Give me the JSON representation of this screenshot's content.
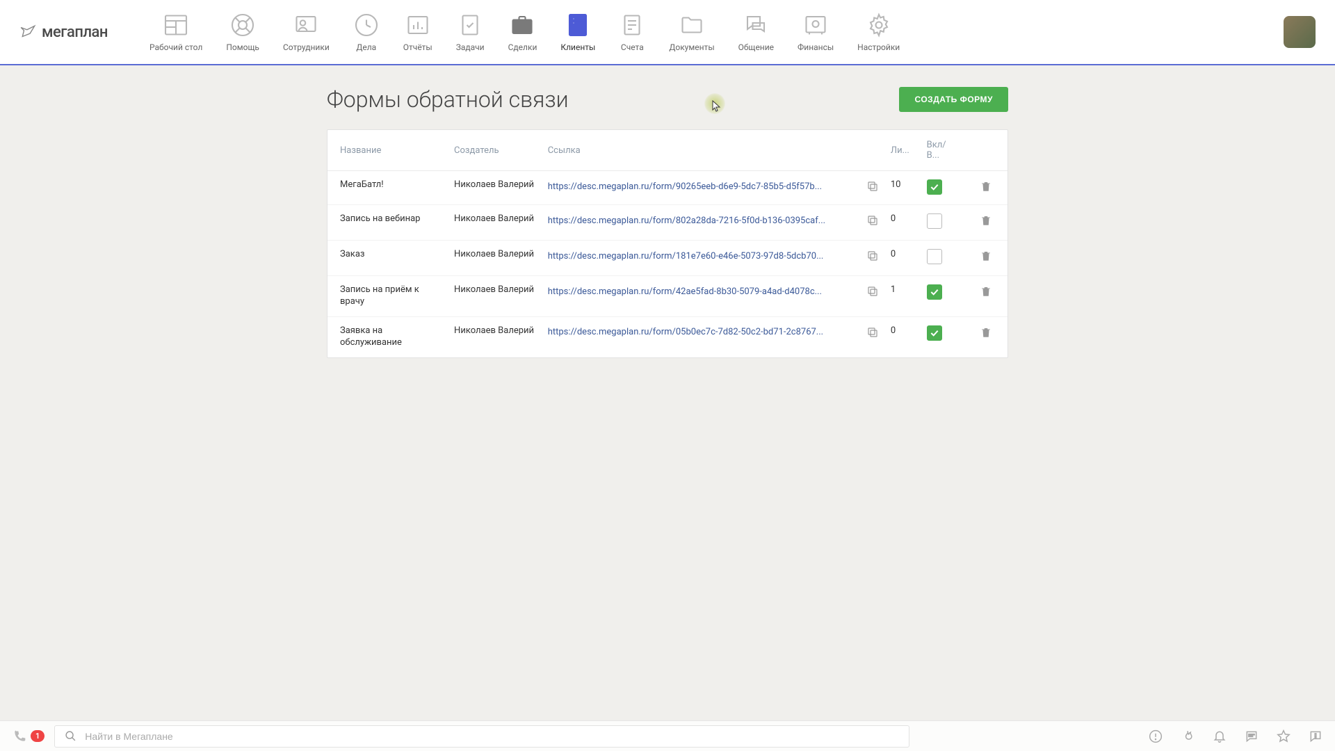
{
  "logo": "мегаплан",
  "topnav": [
    {
      "label": "Рабочий стол"
    },
    {
      "label": "Помощь"
    },
    {
      "label": "Сотрудники"
    },
    {
      "label": "Дела"
    },
    {
      "label": "Отчёты"
    },
    {
      "label": "Задачи"
    },
    {
      "label": "Сделки"
    },
    {
      "label": "Клиенты"
    },
    {
      "label": "Счета"
    },
    {
      "label": "Документы"
    },
    {
      "label": "Общение"
    },
    {
      "label": "Финансы"
    },
    {
      "label": "Настройки"
    }
  ],
  "page": {
    "title": "Формы обратной связи",
    "create_label": "СОЗДАТЬ ФОРМУ"
  },
  "cols": {
    "name": "Название",
    "creator": "Создатель",
    "link": "Ссылка",
    "leads": "Ли...",
    "enabled": "Вкл/В..."
  },
  "rows": [
    {
      "name": "МегаБатл!",
      "creator": "Николаев Валерий",
      "link": "https://desc.megaplan.ru/form/90265eeb-d6e9-5dc7-85b5-d5f57b...",
      "leads": "10",
      "enabled": true
    },
    {
      "name": "Запись на вебинар",
      "creator": "Николаев Валерий",
      "link": "https://desc.megaplan.ru/form/802a28da-7216-5f0d-b136-0395caf...",
      "leads": "0",
      "enabled": false
    },
    {
      "name": "Заказ",
      "creator": "Николаев Валерий",
      "link": "https://desc.megaplan.ru/form/181e7e60-e46e-5073-97d8-5dcb70...",
      "leads": "0",
      "enabled": false
    },
    {
      "name": "Запись на приём к врачу",
      "creator": "Николаев Валерий",
      "link": "https://desc.megaplan.ru/form/42ae5fad-8b30-5079-a4ad-d4078c...",
      "leads": "1",
      "enabled": true
    },
    {
      "name": "Заявка на обслуживание",
      "creator": "Николаев Валерий",
      "link": "https://desc.megaplan.ru/form/05b0ec7c-7d82-50c2-bd71-2c8767...",
      "leads": "0",
      "enabled": true
    }
  ],
  "bottombar": {
    "badge": "1",
    "search_placeholder": "Найти в Мегаплане"
  }
}
